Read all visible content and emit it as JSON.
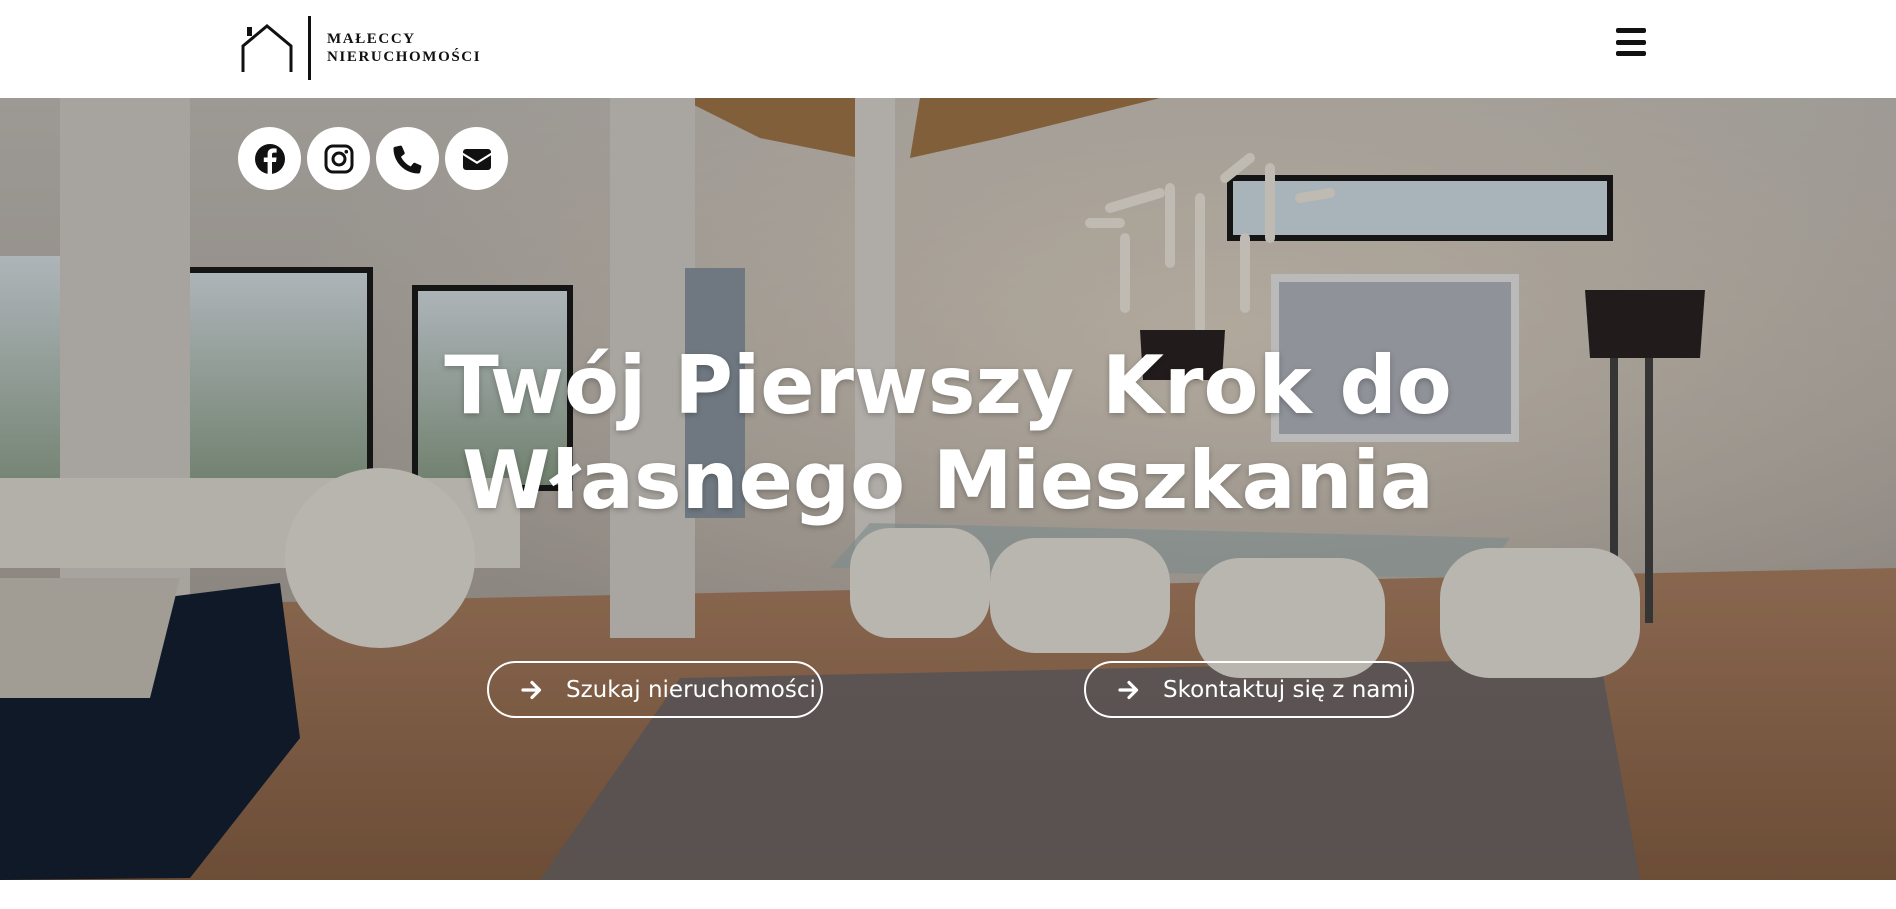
{
  "header": {
    "logo_line1": "MAŁECCY",
    "logo_line2": "NIERUCHOMOŚCI",
    "menu_icon": "hamburger-menu-icon"
  },
  "social": [
    {
      "name": "facebook",
      "icon": "facebook-icon"
    },
    {
      "name": "instagram",
      "icon": "instagram-icon"
    },
    {
      "name": "phone",
      "icon": "phone-icon"
    },
    {
      "name": "email",
      "icon": "envelope-icon"
    }
  ],
  "hero": {
    "title_line1": "Twój Pierwszy Krok do",
    "title_line2": "Własnego Mieszkania",
    "cta_search": "Szukaj nieruchomości",
    "cta_contact": "Skontaktuj się z nami",
    "cta_icon": "arrow-right-icon"
  },
  "colors": {
    "header_bg": "#ffffff",
    "text_dark": "#111111",
    "hero_text": "#ffffff"
  }
}
